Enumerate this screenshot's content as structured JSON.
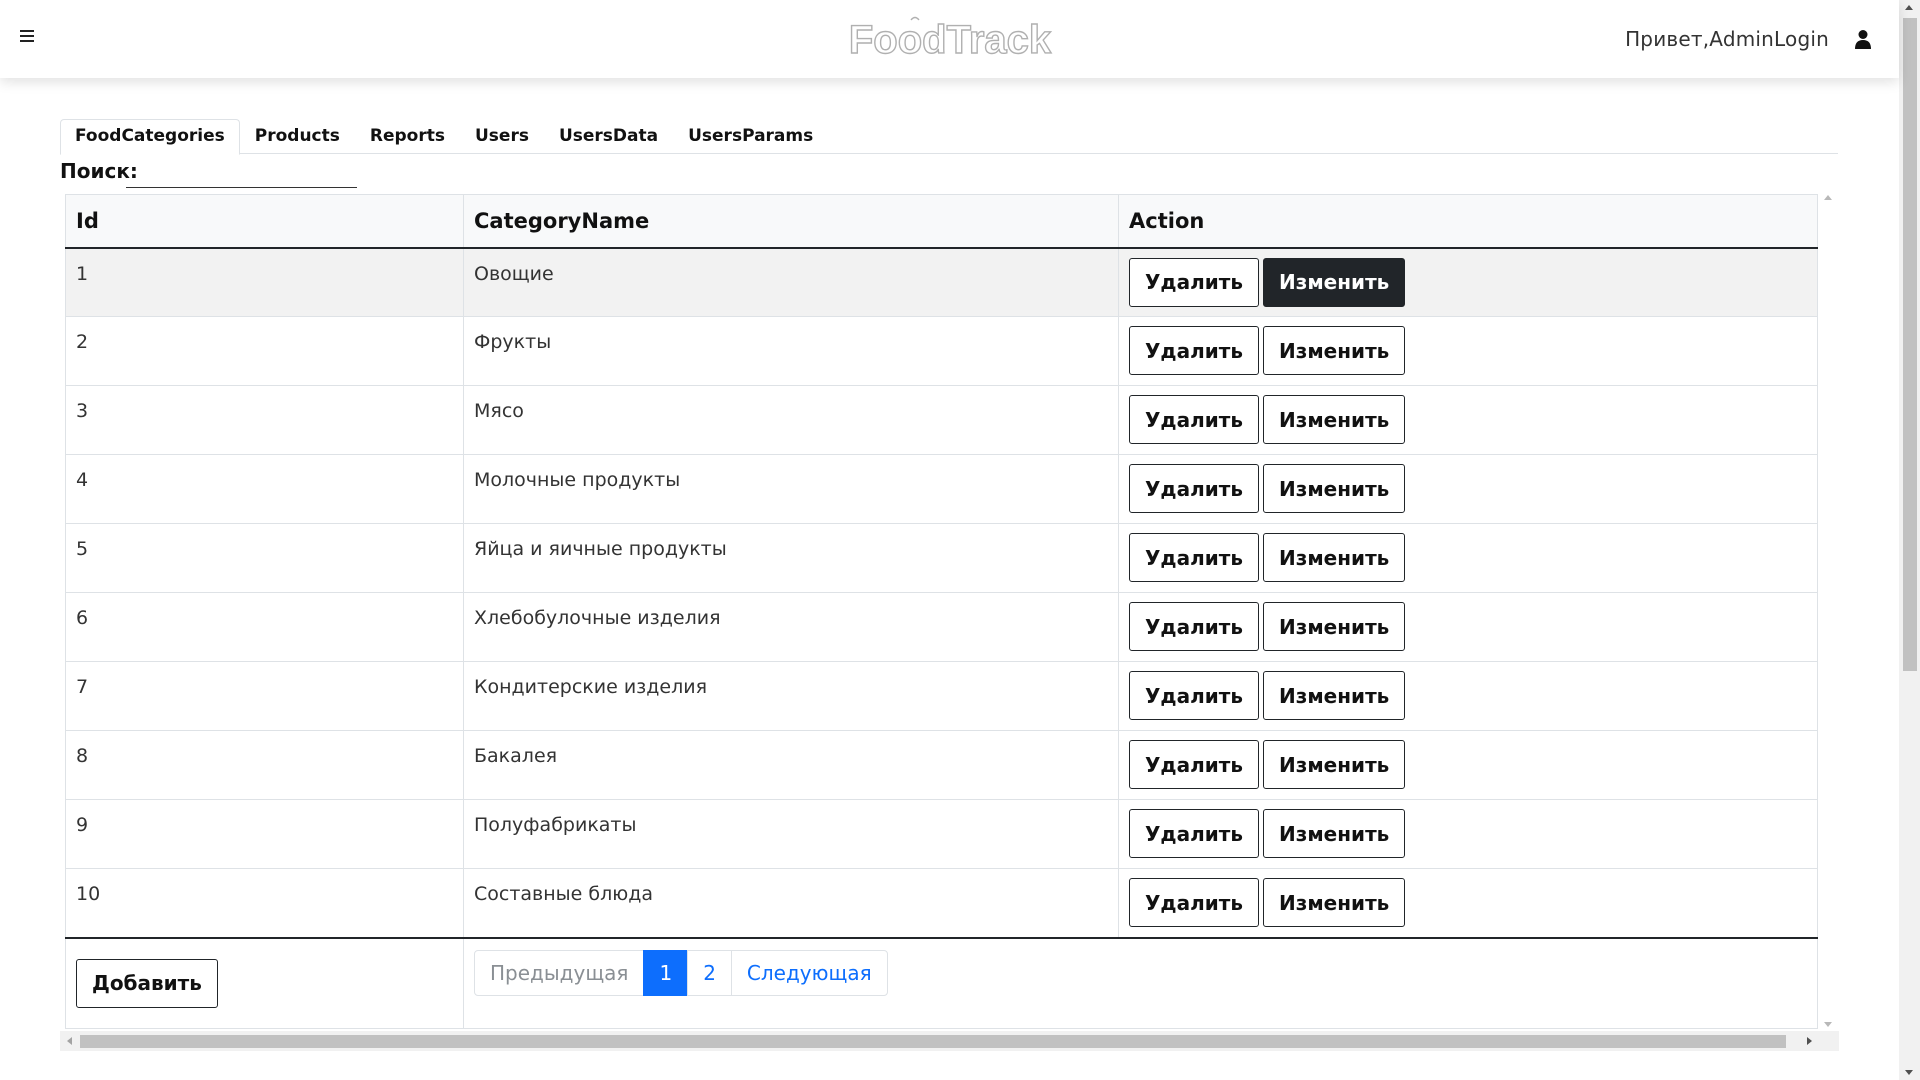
{
  "header": {
    "logo_text": "FoodTrack",
    "greeting": "Привет,AdminLogin",
    "menu_icon": "hamburger-menu-icon",
    "user_icon": "user-icon"
  },
  "tabs": [
    {
      "label": "FoodCategories",
      "active": true
    },
    {
      "label": "Products",
      "active": false
    },
    {
      "label": "Reports",
      "active": false
    },
    {
      "label": "Users",
      "active": false
    },
    {
      "label": "UsersData",
      "active": false
    },
    {
      "label": "UsersParams",
      "active": false
    }
  ],
  "search": {
    "label": "Поиск:",
    "value": "",
    "placeholder": ""
  },
  "table": {
    "columns": [
      "Id",
      "CategoryName",
      "Action"
    ],
    "rows": [
      {
        "id": "1",
        "name": "Овощие"
      },
      {
        "id": "2",
        "name": "Фрукты"
      },
      {
        "id": "3",
        "name": "Мясо"
      },
      {
        "id": "4",
        "name": "Молочные продукты"
      },
      {
        "id": "5",
        "name": "Яйца и яичные продукты"
      },
      {
        "id": "6",
        "name": "Хлебобулочные изделия"
      },
      {
        "id": "7",
        "name": "Кондитерские изделия"
      },
      {
        "id": "8",
        "name": "Бакалея"
      },
      {
        "id": "9",
        "name": "Полуфабрикаты"
      },
      {
        "id": "10",
        "name": "Составные блюда"
      }
    ],
    "delete_label": "Удалить",
    "edit_label": "Изменить"
  },
  "footer": {
    "add_label": "Добавить",
    "pagination": {
      "prev": "Предыдущая",
      "pages": [
        "1",
        "2"
      ],
      "current": "1",
      "next": "Следующая"
    }
  },
  "colors": {
    "accent": "#0d6efd",
    "dark_button": "#212529",
    "header_bg": "#ffffff"
  }
}
